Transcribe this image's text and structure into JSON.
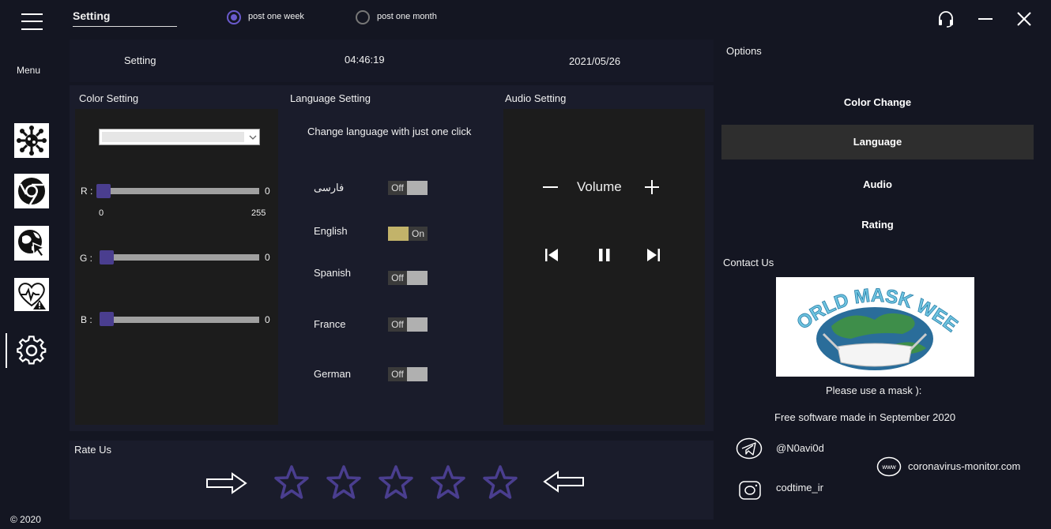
{
  "window": {
    "title": "Setting",
    "controls": [
      "headset-icon",
      "minimize-icon",
      "close-icon"
    ]
  },
  "filters": {
    "week_label": "post one week",
    "month_label": "post one month",
    "selected": "week"
  },
  "sidebar": {
    "menu_label": "Menu",
    "items": [
      {
        "icon": "virus-icon"
      },
      {
        "icon": "chrome-icon"
      },
      {
        "icon": "globe-cursor-icon"
      },
      {
        "icon": "heart-warning-icon"
      },
      {
        "icon": "gear-icon",
        "active": true
      }
    ],
    "copyright": "© 2020"
  },
  "status": {
    "page": "Setting",
    "time": "04:46:19",
    "date": "2021/05/26"
  },
  "color_setting": {
    "title": "Color Setting",
    "r_label": "R :",
    "g_label": "G :",
    "b_label": "B :",
    "r_value": "0",
    "g_value": "0",
    "b_value": "0",
    "min": "0",
    "max": "255"
  },
  "language_setting": {
    "title": "Language Setting",
    "subtitle": "Change language with just one click",
    "languages": [
      {
        "name": "فارسی",
        "state": "Off"
      },
      {
        "name": "English",
        "state": "On"
      },
      {
        "name": "Spanish",
        "state": "Off"
      },
      {
        "name": "France",
        "state": "Off"
      },
      {
        "name": "German",
        "state": "Off"
      }
    ]
  },
  "audio_setting": {
    "title": "Audio Setting",
    "volume_label": "Volume"
  },
  "options": {
    "title": "Options",
    "items": [
      "Color Change",
      "Language",
      "Audio",
      "Rating"
    ],
    "selected": "Language"
  },
  "contact": {
    "title": "Contact Us",
    "logo_text": "WORLD MASK WEEK",
    "mask_note": "Please use a mask ):",
    "made_note": "Free software made in September 2020",
    "telegram": "@N0avi0d",
    "instagram": "codtime_ir",
    "website": "coronavirus-monitor.com",
    "www_badge": "www"
  },
  "rating": {
    "title": "Rate Us",
    "stars": 5
  },
  "colors": {
    "background": "#141622",
    "accent": "#4a3e8f",
    "toggle_on": "#c2b36a"
  }
}
